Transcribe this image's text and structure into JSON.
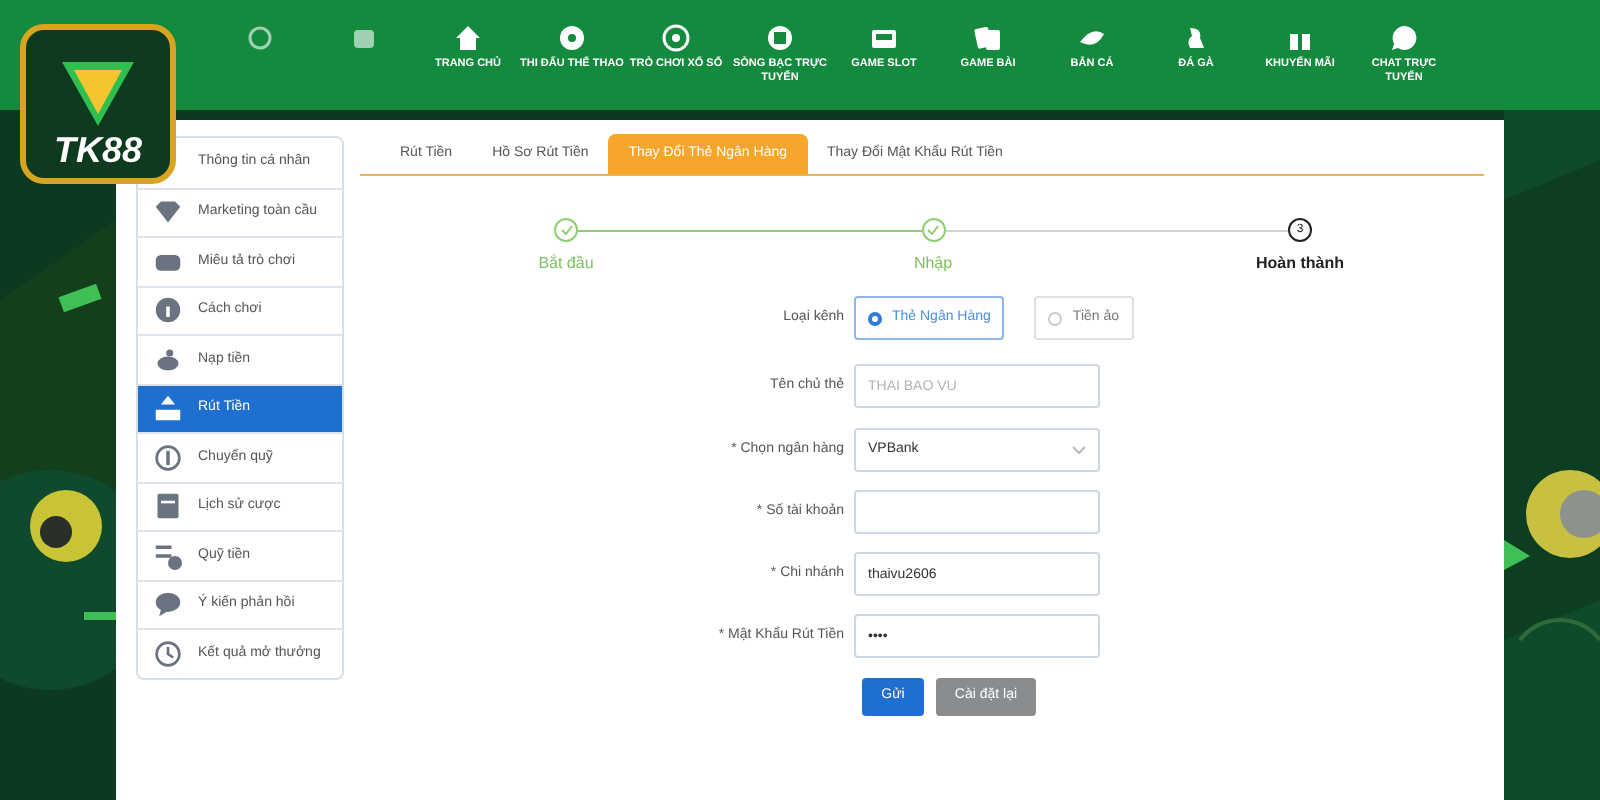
{
  "logo": {
    "text": "TK88"
  },
  "nav": [
    {
      "kind": "icon"
    },
    {
      "kind": "icon"
    },
    {
      "label": "TRANG CHỦ"
    },
    {
      "label": "THI ĐẤU THỂ THAO"
    },
    {
      "label": "TRÒ CHƠI XỔ SỐ"
    },
    {
      "label": "SÒNG BẠC TRỰC TUYẾN"
    },
    {
      "label": "GAME SLOT"
    },
    {
      "label": "GAME BÀI"
    },
    {
      "label": "BẮN CÁ"
    },
    {
      "label": "ĐÁ GÀ"
    },
    {
      "label": "KHUYẾN MÃI"
    },
    {
      "label": "CHAT TRỰC TUYẾN"
    }
  ],
  "sidebar": {
    "items": [
      {
        "label": "Thông tin cá nhân",
        "selected": false
      },
      {
        "label": "Marketing toàn cầu",
        "selected": false
      },
      {
        "label": "Miêu tả trò chơi",
        "selected": false
      },
      {
        "label": "Cách chơi",
        "selected": false
      },
      {
        "label": "Nạp tiền",
        "selected": false
      },
      {
        "label": "Rút Tiền",
        "selected": true
      },
      {
        "label": "Chuyển quỹ",
        "selected": false
      },
      {
        "label": "Lịch sử cược",
        "selected": false
      },
      {
        "label": "Quỹ tiền",
        "selected": false
      },
      {
        "label": "Ý kiến phản hồi",
        "selected": false
      },
      {
        "label": "Kết quả mở thưởng",
        "selected": false
      }
    ]
  },
  "tabs": [
    {
      "label": "Rút Tiền",
      "selected": false
    },
    {
      "label": "Hồ Sơ Rút Tiền",
      "selected": false
    },
    {
      "label": "Thay Đổi Thẻ Ngân Hàng",
      "selected": true
    },
    {
      "label": "Thay Đổi Mật Khẩu Rút Tiền",
      "selected": false
    }
  ],
  "steps": [
    {
      "label": "Bắt đầu",
      "done": true
    },
    {
      "label": "Nhập",
      "done": true
    },
    {
      "label": "Hoàn thành",
      "done": false,
      "number": "3"
    }
  ],
  "form": {
    "rows": [
      {
        "kind": "radio",
        "label": "Loại kênh",
        "options": [
          {
            "label": "Thẻ Ngân Hàng",
            "selected": true
          },
          {
            "label": "Tiền ảo",
            "selected": false
          }
        ]
      },
      {
        "kind": "text",
        "label": "Tên chủ thẻ",
        "placeholder": "THAI BAO VU"
      },
      {
        "kind": "select",
        "label": "* Chọn ngân hàng",
        "value": "VPBank"
      },
      {
        "kind": "text",
        "label": "* Số tài khoản"
      },
      {
        "kind": "text",
        "label": "* Chi nhánh",
        "value": "thaivu2606"
      },
      {
        "kind": "text",
        "label": "* Mật Khẩu Rút Tiền",
        "value": "••••"
      }
    ],
    "buttons": [
      {
        "label": "Gửi",
        "kind": "primary"
      },
      {
        "label": "Cài đặt lại",
        "kind": "secondary"
      }
    ]
  }
}
